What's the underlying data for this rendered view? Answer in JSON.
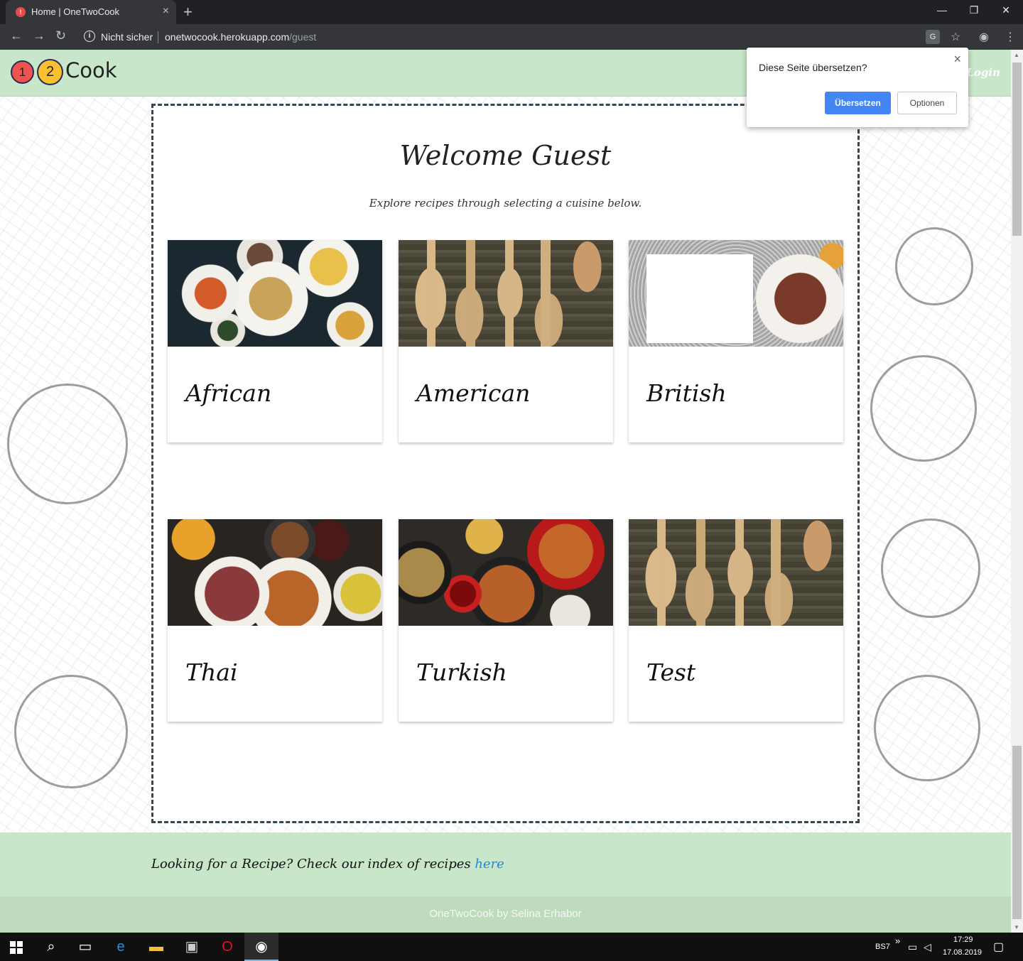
{
  "browser": {
    "tab_title": "Home | OneTwoCook",
    "tab_favicon": "!",
    "tab_close": "×",
    "new_tab": "+",
    "security_label": "Nicht sicher",
    "url_host": "onetwocook.herokuapp.com",
    "url_path": "/guest",
    "window_controls": [
      "—",
      "❐",
      "✕"
    ]
  },
  "navbar": {
    "logo_one": "1",
    "logo_two": "2",
    "logo_text": "Cook",
    "login_label": "Login"
  },
  "main": {
    "welcome": "Welcome Guest",
    "subtitle": "Explore recipes through selecting a cuisine below.",
    "cuisines": [
      {
        "name": "African"
      },
      {
        "name": "American"
      },
      {
        "name": "British"
      },
      {
        "name": "Thai"
      },
      {
        "name": "Turkish"
      },
      {
        "name": "Test"
      }
    ]
  },
  "footer": {
    "prompt": "Looking for a Recipe? Check our index of recipes ",
    "link": "here",
    "credit": "OneTwoCook by Selina Erhabor"
  },
  "translate_popup": {
    "title": "Diese Seite übersetzen?",
    "close": "×",
    "translate_button": "Übersetzen",
    "options_button": "Optionen"
  },
  "taskbar": {
    "lang": "BS7",
    "chevron": "»",
    "time": "17:29",
    "date": "17.08.2019"
  },
  "colors": {
    "navbar_green": "#c8e6c9",
    "logo_red": "#ef5350",
    "logo_yellow": "#fbc02d",
    "link_blue": "#1e88e5",
    "translate_blue": "#4285f4"
  }
}
